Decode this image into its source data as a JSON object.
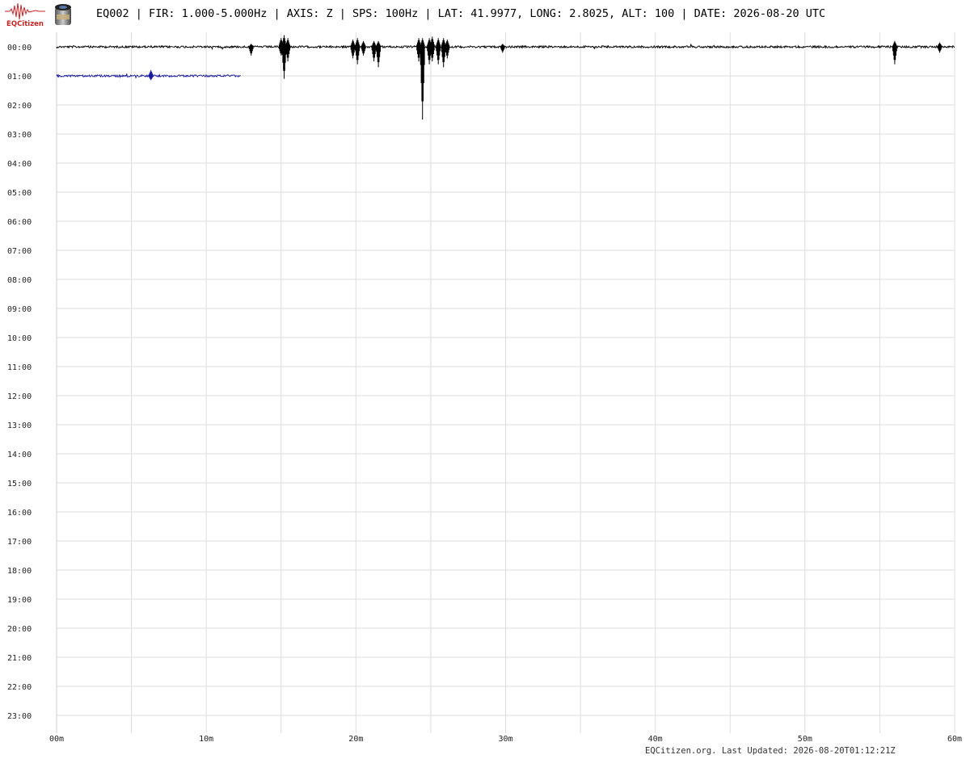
{
  "header": {
    "logo_text": "EQCitizen",
    "title": "EQ002 | FIR: 1.000-5.000Hz | AXIS: Z | SPS: 100Hz | LAT: 41.9977, LONG: 2.8025, ALT: 100 | DATE: 2026-08-20 UTC"
  },
  "footer": {
    "updated": "EQCitizen.org. Last Updated: 2026-08-20T01:12:21Z"
  },
  "colors": {
    "trace_a": "#000000",
    "trace_b": "#1a1aa0",
    "grid": "#dddddd",
    "logo": "#cc2222"
  },
  "chart_data": {
    "type": "line",
    "chart_kind": "helicorder",
    "grid": true,
    "x_unit": "minutes",
    "xlim": [
      0,
      60
    ],
    "x_ticks": [
      "00m",
      "10m",
      "20m",
      "30m",
      "40m",
      "50m",
      "60m"
    ],
    "row_labels": [
      "00:00",
      "01:00",
      "02:00",
      "03:00",
      "04:00",
      "05:00",
      "06:00",
      "07:00",
      "08:00",
      "09:00",
      "10:00",
      "11:00",
      "12:00",
      "13:00",
      "14:00",
      "15:00",
      "16:00",
      "17:00",
      "18:00",
      "19:00",
      "20:00",
      "21:00",
      "22:00",
      "23:00"
    ],
    "series": [
      {
        "row": "00:00",
        "x_range": [
          0,
          60
        ],
        "color_key": "trace_a",
        "events": [
          {
            "minute": 13.0,
            "up": 0.1,
            "down": 0.3
          },
          {
            "minute": 15.0,
            "up": 0.3,
            "down": 0.3
          },
          {
            "minute": 15.2,
            "up": 0.4,
            "down": 1.1
          },
          {
            "minute": 15.45,
            "up": 0.3,
            "down": 0.5
          },
          {
            "minute": 19.8,
            "up": 0.25,
            "down": 0.4
          },
          {
            "minute": 20.1,
            "up": 0.3,
            "down": 0.6
          },
          {
            "minute": 20.5,
            "up": 0.2,
            "down": 0.3
          },
          {
            "minute": 21.2,
            "up": 0.2,
            "down": 0.5
          },
          {
            "minute": 21.5,
            "up": 0.2,
            "down": 0.7
          },
          {
            "minute": 24.2,
            "up": 0.3,
            "down": 0.5
          },
          {
            "minute": 24.45,
            "up": 0.3,
            "down": 2.5
          },
          {
            "minute": 24.9,
            "up": 0.3,
            "down": 0.6
          },
          {
            "minute": 25.1,
            "up": 0.35,
            "down": 0.5
          },
          {
            "minute": 25.5,
            "up": 0.3,
            "down": 0.6
          },
          {
            "minute": 25.85,
            "up": 0.3,
            "down": 0.7
          },
          {
            "minute": 26.1,
            "up": 0.25,
            "down": 0.4
          },
          {
            "minute": 29.8,
            "up": 0.1,
            "down": 0.2
          },
          {
            "minute": 56.0,
            "up": 0.2,
            "down": 0.6
          },
          {
            "minute": 59.0,
            "up": 0.15,
            "down": 0.2
          }
        ]
      },
      {
        "row": "01:00",
        "x_range": [
          0,
          12.3
        ],
        "color_key": "trace_b",
        "events": [
          {
            "minute": 6.3,
            "up": 0.2,
            "down": 0.15
          }
        ]
      }
    ]
  }
}
